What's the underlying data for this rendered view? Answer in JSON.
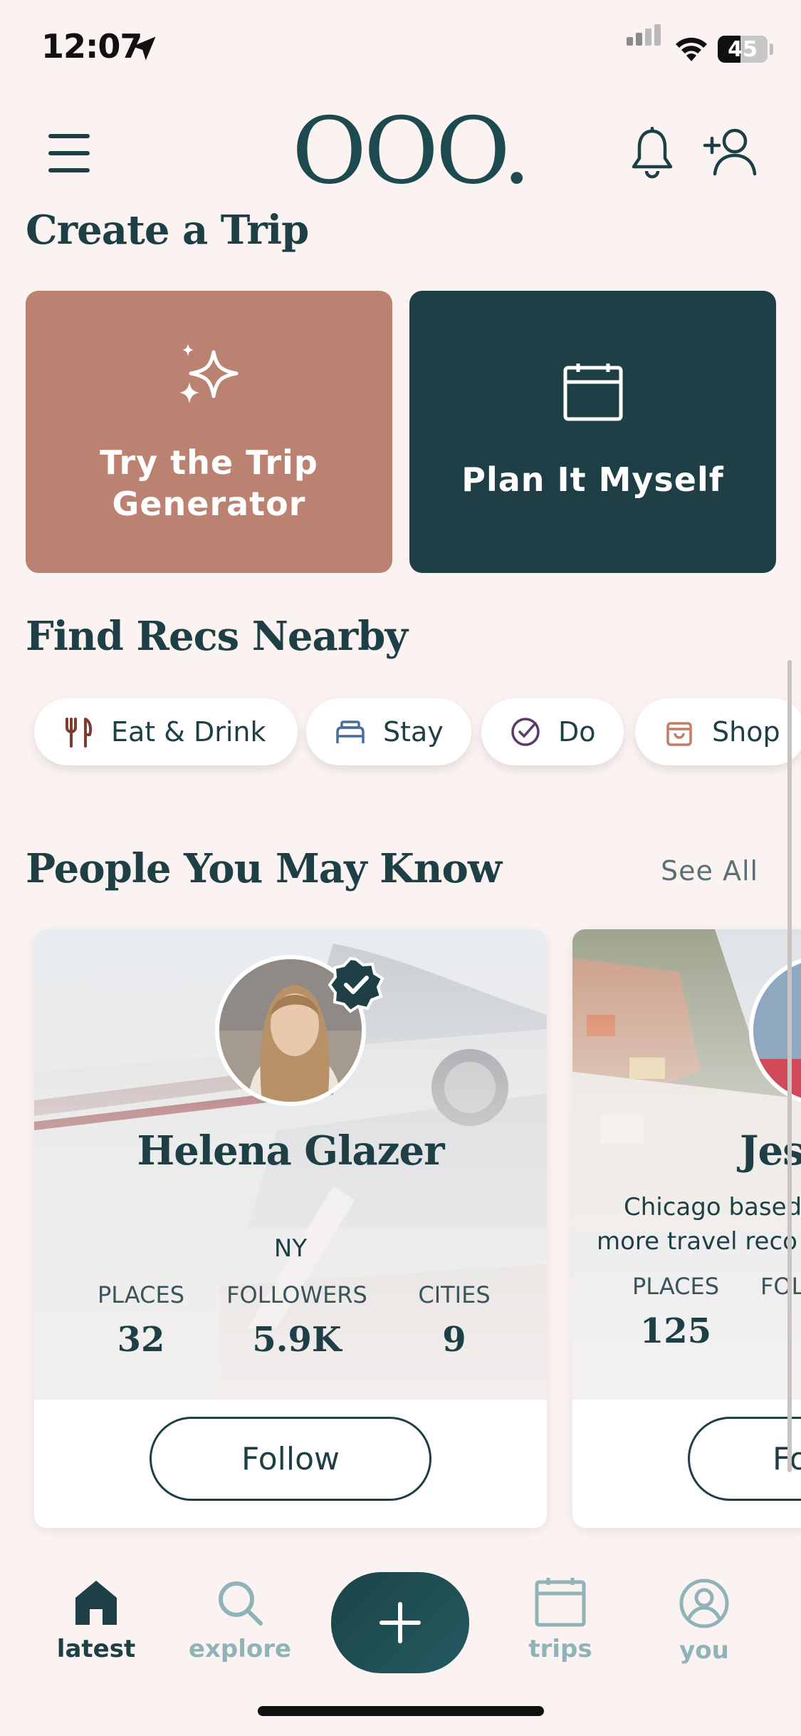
{
  "status_bar": {
    "time": "12:07",
    "battery": "45",
    "battery_level": 0.45
  },
  "header": {
    "logo": "OOO."
  },
  "create_trip": {
    "title": "Create a Trip",
    "generator_line1": "Try the Trip",
    "generator_line2": "Generator",
    "plan_label": "Plan It Myself"
  },
  "find_recs": {
    "title": "Find Recs Nearby",
    "chips": [
      {
        "label": "Eat & Drink",
        "icon": "fork-knife-icon"
      },
      {
        "label": "Stay",
        "icon": "bed-icon"
      },
      {
        "label": "Do",
        "icon": "check-circle-icon"
      },
      {
        "label": "Shop",
        "icon": "shopping-bag-icon"
      }
    ]
  },
  "people": {
    "title": "People You May Know",
    "see_all": "See All",
    "cards": [
      {
        "name": "Helena Glazer",
        "location": "NY",
        "places_label": "PLACES",
        "places": "32",
        "followers_label": "FOLLOWERS",
        "followers": "5.9K",
        "cities_label": "CITIES",
        "cities": "9",
        "follow": "Follow"
      },
      {
        "name": "Jes",
        "bio_line1": "Chicago based",
        "bio_line2": "more travel reco",
        "places_label": "PLACES",
        "places": "125",
        "followers_label": "FOL",
        "follow": "Fo"
      }
    ]
  },
  "tabs": [
    {
      "label": "latest",
      "icon": "home-icon",
      "active": true
    },
    {
      "label": "explore",
      "icon": "search-icon",
      "active": false
    },
    {
      "label": "trips",
      "icon": "calendar-icon",
      "active": false
    },
    {
      "label": "you",
      "icon": "user-icon",
      "active": false
    }
  ],
  "colors": {
    "background": "#fbf3f1",
    "primary": "#1d3f45",
    "accent": "#bb8171",
    "inactive_tab": "#8fb3b7"
  }
}
